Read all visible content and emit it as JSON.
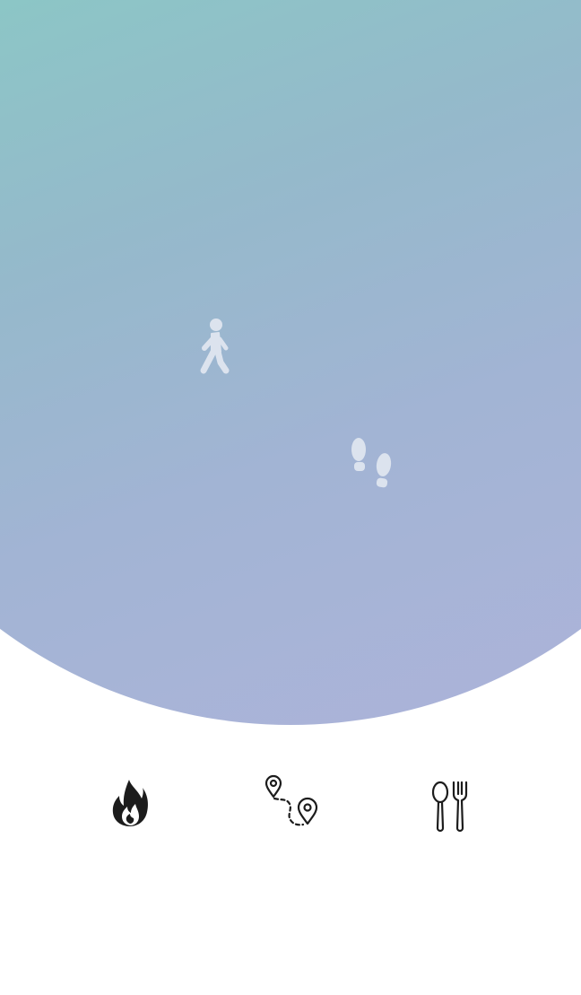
{
  "hero": {
    "gradient": [
      "#8cc6c6",
      "#95b9cb",
      "#a2b4d4",
      "#adb3da"
    ],
    "icons": [
      "walking-person-icon",
      "footsteps-icon"
    ],
    "icon_color": "#dce3ee"
  },
  "features": {
    "icons": [
      "calories-flame-icon",
      "route-distance-icon",
      "food-spoon-fork-icon"
    ],
    "icon_color": "#1c1c1c"
  }
}
